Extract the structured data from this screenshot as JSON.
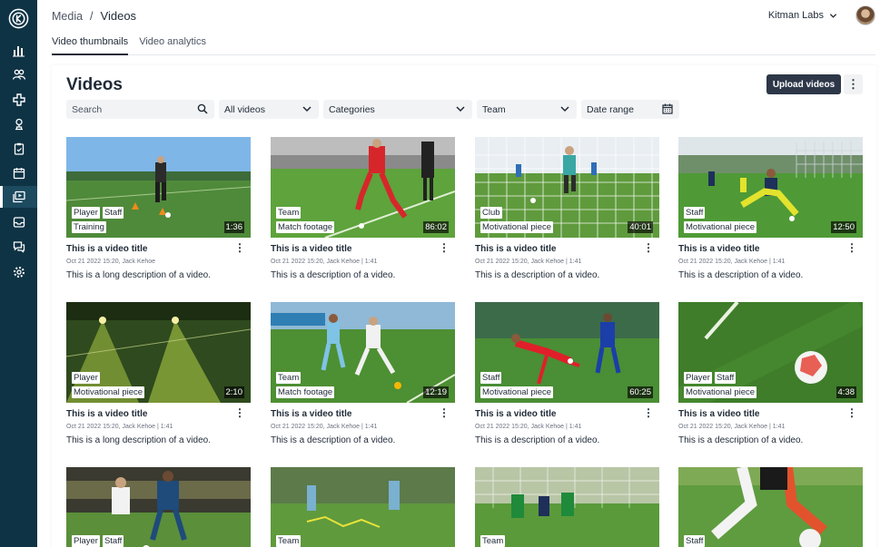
{
  "colors": {
    "sidebar_bg": "#0e3345",
    "primary_button": "#2d3748",
    "field_bg": "#f2f3f5",
    "accent_white": "#ffffff"
  },
  "sidebar": {
    "logo": "kitman-logo",
    "items": [
      {
        "icon": "bar-chart-icon"
      },
      {
        "icon": "people-icon"
      },
      {
        "icon": "medical-cross-icon"
      },
      {
        "icon": "trophy-icon"
      },
      {
        "icon": "clipboard-icon"
      },
      {
        "icon": "calendar-icon"
      },
      {
        "icon": "media-icon",
        "active": true
      },
      {
        "icon": "inbox-icon"
      },
      {
        "icon": "messages-icon"
      },
      {
        "icon": "settings-icon"
      }
    ]
  },
  "header": {
    "breadcrumb": {
      "parent": "Media",
      "separator": "/",
      "current": "Videos"
    },
    "org_name": "Kitman Labs"
  },
  "tabs": [
    {
      "label": "Video thumbnails",
      "active": true
    },
    {
      "label": "Video analytics",
      "active": false
    }
  ],
  "page": {
    "title": "Videos",
    "upload_label": "Upload videos",
    "more_label": "⋮"
  },
  "filters": {
    "search_placeholder": "Search",
    "videos_select": "All videos",
    "categories_select": "Categories",
    "team_select": "Team",
    "date_range": "Date range"
  },
  "videos": [
    {
      "tags": [
        [
          "Player",
          "Staff"
        ],
        [
          "Training"
        ]
      ],
      "duration": "1:36",
      "title": "This is a video title",
      "meta": "Oct 21 2022 15:20, Jack Kehoe",
      "description": "This is a long description of a video."
    },
    {
      "tags": [
        [
          "Team"
        ],
        [
          "Match footage"
        ]
      ],
      "duration": "86:02",
      "title": "This is a video title",
      "meta": "Oct 21 2022 15:20, Jack Kehoe | 1:41",
      "description": "This is a description of a video."
    },
    {
      "tags": [
        [
          "Club"
        ],
        [
          "Motivational piece"
        ]
      ],
      "duration": "40:01",
      "title": "This is a video title",
      "meta": "Oct 21 2022 15:20, Jack Kehoe | 1:41",
      "description": "This is a description of a video."
    },
    {
      "tags": [
        [
          "Staff"
        ],
        [
          "Motivational piece"
        ]
      ],
      "duration": "12:50",
      "title": "This is a video title",
      "meta": "Oct 21 2022 15:20, Jack Kehoe | 1:41",
      "description": "This is a description of a video."
    },
    {
      "tags": [
        [
          "Player"
        ],
        [
          "Motivational piece"
        ]
      ],
      "duration": "2:10",
      "title": "This is a video title",
      "meta": "Oct 21 2022 15:20, Jack Kehoe | 1:41",
      "description": "This is a long description of a video."
    },
    {
      "tags": [
        [
          "Team"
        ],
        [
          "Match footage"
        ]
      ],
      "duration": "12:19",
      "title": "This is a video title",
      "meta": "Oct 21 2022 15:20, Jack Kehoe | 1:41",
      "description": "This is a description of a video."
    },
    {
      "tags": [
        [
          "Staff"
        ],
        [
          "Motivational piece"
        ]
      ],
      "duration": "60:25",
      "title": "This is a video title",
      "meta": "Oct 21 2022 15:20, Jack Kehoe | 1:41",
      "description": "This is a description of a video."
    },
    {
      "tags": [
        [
          "Player",
          "Staff"
        ],
        [
          "Motivational piece"
        ]
      ],
      "duration": "4:38",
      "title": "This is a video title",
      "meta": "Oct 21 2022 15:20, Jack Kehoe | 1:41",
      "description": "This is a description of a video."
    },
    {
      "tags": [
        [
          "Player",
          "Staff"
        ]
      ],
      "duration": "",
      "title": "",
      "meta": "",
      "description": ""
    },
    {
      "tags": [
        [
          "Team"
        ]
      ],
      "duration": "",
      "title": "",
      "meta": "",
      "description": ""
    },
    {
      "tags": [
        [
          "Team"
        ]
      ],
      "duration": "",
      "title": "",
      "meta": "",
      "description": ""
    },
    {
      "tags": [
        [
          "Staff"
        ]
      ],
      "duration": "",
      "title": "",
      "meta": "",
      "description": ""
    }
  ]
}
